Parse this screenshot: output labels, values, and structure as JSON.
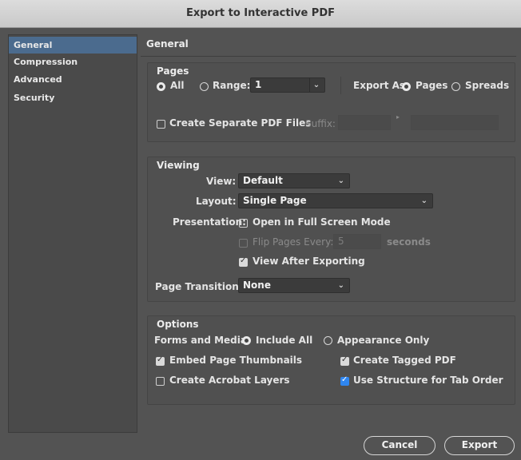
{
  "window": {
    "title": "Export to Interactive PDF"
  },
  "sidebar": {
    "items": [
      {
        "label": "General",
        "selected": true
      },
      {
        "label": "Compression",
        "selected": false
      },
      {
        "label": "Advanced",
        "selected": false
      },
      {
        "label": "Security",
        "selected": false
      }
    ]
  },
  "main": {
    "title": "General"
  },
  "pages": {
    "group_label": "Pages",
    "all_label": "All",
    "range_label": "Range:",
    "range_value": "1",
    "export_as_label": "Export As",
    "pages_option": "Pages",
    "spreads_option": "Spreads",
    "create_separate_label": "Create Separate PDF Files",
    "suffix_label": "Suffix:"
  },
  "viewing": {
    "group_label": "Viewing",
    "view_label": "View:",
    "view_value": "Default",
    "layout_label": "Layout:",
    "layout_value": "Single Page",
    "presentation_label": "Presentation:",
    "full_screen_label": "Open in Full Screen Mode",
    "flip_pages_label": "Flip Pages Every:",
    "flip_value": "5",
    "seconds_label": "seconds",
    "view_after_label": "View After Exporting",
    "transitions_label": "Page Transitions:",
    "transitions_value": "None"
  },
  "options": {
    "group_label": "Options",
    "forms_label": "Forms and Media:",
    "include_all_label": "Include All",
    "appearance_only_label": "Appearance Only",
    "embed_thumbnails_label": "Embed Page Thumbnails",
    "tagged_pdf_label": "Create Tagged PDF",
    "acrobat_layers_label": "Create Acrobat Layers",
    "tab_order_label": "Use Structure for Tab Order"
  },
  "buttons": {
    "cancel": "Cancel",
    "export": "Export"
  },
  "colors": {
    "accent": "#2f86f0",
    "selection": "#4b6b8e"
  }
}
